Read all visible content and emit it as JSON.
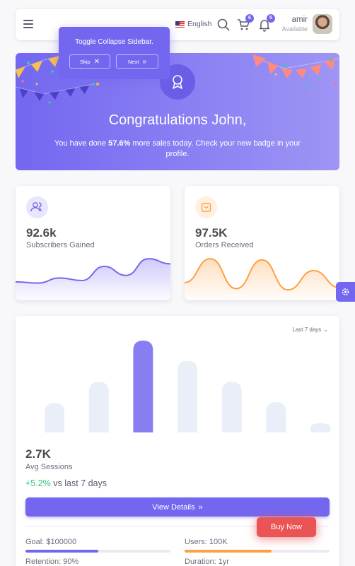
{
  "header": {
    "language": "English",
    "cart_count": "6",
    "notification_count": "5",
    "user_name": "amir",
    "user_status": "Available"
  },
  "tour_tooltip": {
    "text": "Toggle Collapse Sidebar.",
    "skip_label": "Skip",
    "next_label": "Next"
  },
  "hero": {
    "title": "Congratulations John,",
    "subtitle_prefix": "You have done ",
    "subtitle_highlight": "57.6%",
    "subtitle_suffix": " more sales today. Check your new badge in your profile."
  },
  "stats": [
    {
      "value": "92.6k",
      "label": "Subscribers Gained",
      "icon": "users-icon",
      "color": "#7367f0",
      "series": [
        20,
        18,
        26,
        22,
        44,
        30,
        56,
        48
      ]
    },
    {
      "value": "97.5K",
      "label": "Orders Received",
      "icon": "shopping-bag-icon",
      "color": "#ff9f43",
      "series": [
        20,
        60,
        10,
        58,
        8,
        40,
        12
      ]
    }
  ],
  "sessions": {
    "range_label": "Last 7 days",
    "value": "2.7K",
    "label": "Avg Sessions",
    "change": "+5.2%",
    "change_suffix": " vs last 7 days",
    "button_label": "View Details",
    "goal_label": "Goal: $100000",
    "users_label": "Users: 100K",
    "retention_label": "Retention: 90%",
    "duration_label": "Duration: 1yr",
    "goal_progress": 0.5,
    "users_progress": 0.6,
    "colors": {
      "primary": "#7367f0",
      "warning": "#ff9f43"
    }
  },
  "buy_now_label": "Buy Now",
  "chart_data": {
    "type": "bar",
    "categories": [
      "",
      "",
      "",
      "",
      "",
      "",
      ""
    ],
    "values": [
      32,
      55,
      100,
      78,
      55,
      33,
      10
    ],
    "highlight_index": 2,
    "colors": {
      "bar": "#e9eef8",
      "active": "#7367f0"
    }
  }
}
